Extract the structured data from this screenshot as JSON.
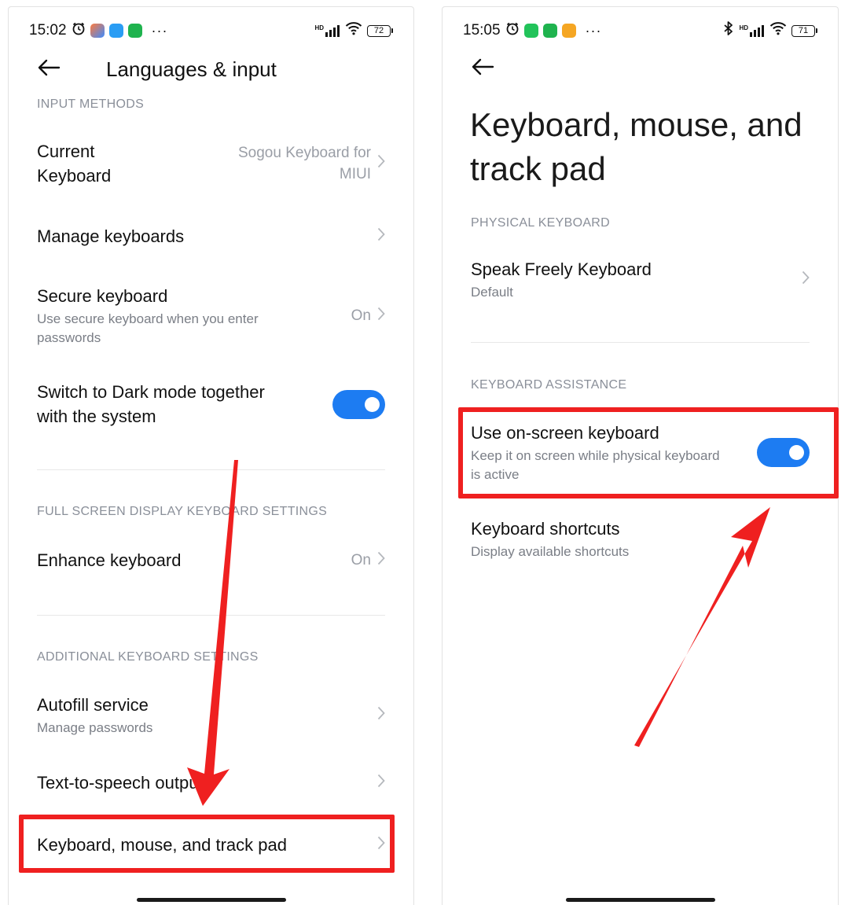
{
  "left_screen": {
    "status": {
      "time": "15:02",
      "battery": "72",
      "more": "···",
      "network": "HD"
    },
    "title": "Languages & input",
    "sections": {
      "input_methods": "INPUT METHODS",
      "full_screen": "FULL SCREEN DISPLAY KEYBOARD SETTINGS",
      "additional": "ADDITIONAL KEYBOARD SETTINGS"
    },
    "items": {
      "current_keyboard": {
        "title_line1": "Current",
        "title_line2": "Keyboard",
        "value_line1": "Sogou Keyboard for",
        "value_line2": "MIUI"
      },
      "manage_keyboards": {
        "title": "Manage keyboards"
      },
      "secure_keyboard": {
        "title": "Secure keyboard",
        "subtitle_line1": "Use secure keyboard when you enter",
        "subtitle_line2": "passwords",
        "value": "On"
      },
      "dark_mode": {
        "title_line1": "Switch to Dark mode together",
        "title_line2": "with the system",
        "enabled": true
      },
      "enhance_keyboard": {
        "title": "Enhance keyboard",
        "value": "On"
      },
      "autofill": {
        "title": "Autofill service",
        "subtitle": "Manage passwords"
      },
      "tts": {
        "title": "Text-to-speech output"
      },
      "keyboard_mouse": {
        "title": "Keyboard, mouse, and track pad"
      }
    }
  },
  "right_screen": {
    "status": {
      "time": "15:05",
      "battery": "71",
      "more": "···",
      "network": "HD"
    },
    "title": "Keyboard, mouse, and track pad",
    "sections": {
      "physical": "PHYSICAL KEYBOARD",
      "assistance": "KEYBOARD ASSISTANCE"
    },
    "items": {
      "speak_freely": {
        "title": "Speak Freely Keyboard",
        "subtitle": "Default"
      },
      "on_screen": {
        "title": "Use on-screen keyboard",
        "subtitle_line1": "Keep it on screen while physical keyboard",
        "subtitle_line2": "is active",
        "enabled": true
      },
      "shortcuts": {
        "title": "Keyboard shortcuts",
        "subtitle": "Display available shortcuts"
      }
    }
  },
  "colors": {
    "accent": "#1d7cf2",
    "annotation": "#ef2020",
    "section_header": "#8a8f99",
    "secondary_text": "#7a7e86"
  },
  "icons": [
    "back-arrow-icon",
    "chevron-right-icon",
    "alarm-icon",
    "signal-icon",
    "wifi-icon",
    "battery-icon",
    "bluetooth-icon"
  ]
}
